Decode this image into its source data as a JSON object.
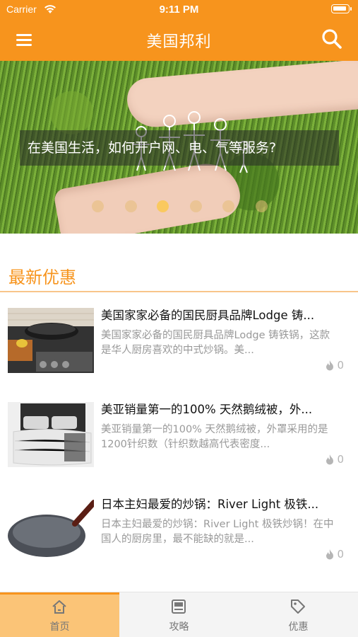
{
  "status_bar": {
    "carrier": "Carrier",
    "time": "9:11 PM"
  },
  "nav": {
    "title": "美国邦利",
    "menu_icon": "menu-icon",
    "search_icon": "search-icon"
  },
  "banner": {
    "caption": "在美国生活，如何开户网、电、气等服务?",
    "dots_total": 6,
    "active_dot_index": 2
  },
  "section": {
    "title": "最新优惠"
  },
  "items": [
    {
      "title": "美国家家必备的国民厨具品牌Lodge 铸...",
      "description": "美国家家必备的国民厨具品牌Lodge 铸铁锅，这款是华人厨房喜欢的中式炒锅。美...",
      "likes": "0",
      "image": "wok on stove"
    },
    {
      "title": "美亚销量第一的100% 天然鹅绒被，外...",
      "description": "美亚销量第一的100% 天然鹅绒被，外罩采用的是1200针织数（针织数越高代表密度...",
      "likes": "0",
      "image": "down comforter on bed"
    },
    {
      "title": "日本主妇最爱的炒锅：River Light 极铁...",
      "description": "日本主妇最爱的炒锅：River Light 极铁炒锅！在中国人的厨房里，最不能缺的就是...",
      "likes": "0",
      "image": "iron frying pan"
    }
  ],
  "tabs": [
    {
      "label": "首页",
      "icon": "home-icon",
      "active": true
    },
    {
      "label": "攻略",
      "icon": "guide-icon",
      "active": false
    },
    {
      "label": "优惠",
      "icon": "tag-icon",
      "active": false
    }
  ],
  "colors": {
    "accent": "#f7941d",
    "active_tab_bg": "#fbc477",
    "divider": "#f8c58a"
  }
}
